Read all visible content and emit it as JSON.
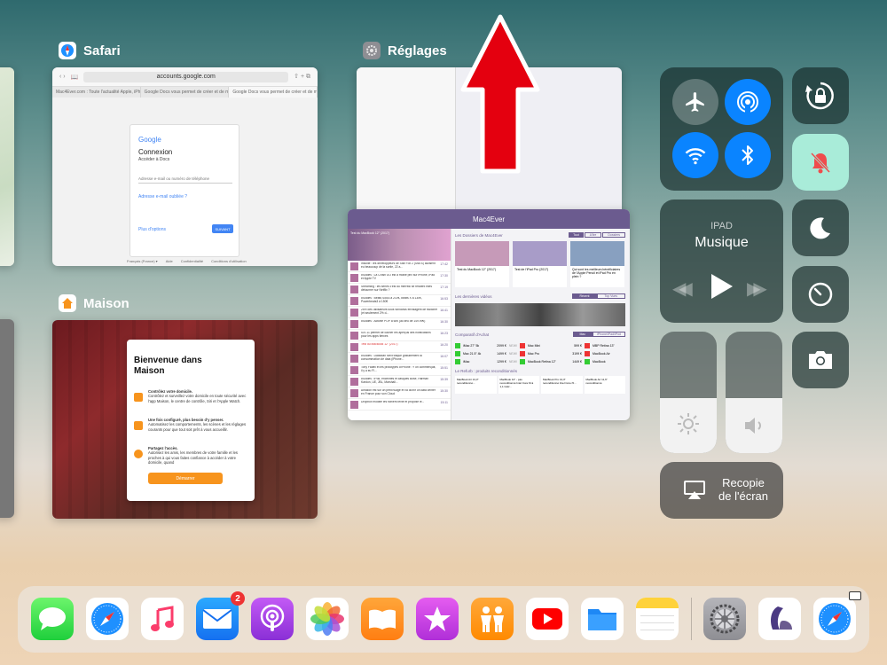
{
  "apps": {
    "safari": {
      "title": "Safari",
      "url": "accounts.google.com",
      "tabs": [
        "Mac4Ever.com : Toute l'actualité Apple, iPhone, iPa...",
        "Google Docs vous permet de créer et de modifier d...",
        "Google Docs vous permet de créer et de modifier..."
      ],
      "login": {
        "logo": "Google",
        "heading": "Connexion",
        "subheading": "Accéder à Docs",
        "email_placeholder": "Adresse e-mail ou numéro de téléphone",
        "forgot_link": "Adresse e-mail oubliée ?",
        "more_options": "Plus d'options",
        "next_button": "SUIVANT",
        "footer": [
          "Français (France) ▾",
          "Aide",
          "Confidentialité",
          "Conditions d'utilisation"
        ]
      }
    },
    "reglages": {
      "title": "Réglages"
    },
    "maison": {
      "title": "Maison",
      "welcome_title": "Bienvenue dans Maison",
      "features": [
        {
          "title": "Contrôlez votre domicile.",
          "text": "Contrôlez et surveillez votre domicile en toute sécurité avec l'app Maison, le centre de contrôle, Siri et l'Apple Watch."
        },
        {
          "title": "Une fois configuré, plus besoin d'y penser.",
          "text": "Automatisez les comportements, les scènes et les réglages courants pour que tout soit prêt à vous accueillir."
        },
        {
          "title": "Partagez l'accès.",
          "text": "Autorisez les amis, les membres de votre famille et les proches à qui vous faites confiance à accéder à votre domicile, quand"
        }
      ],
      "start_button": "Démarrer"
    },
    "mac4ever": {
      "title": "Mac4Ever",
      "featured": "Test du MacBook 12\" (2017)",
      "news": [
        {
          "text": "Insolite : les développeurs de Star Fox 2 (SNES) auraient eu beaucoup de la sortie, 22 a...",
          "time": "17:42"
        },
        {
          "text": "#Soldes : La Crosfi GO est à moitié prix sur iPhone, iPad et Apple TV",
          "time": "17:30"
        },
        {
          "text": "Streaming : les séries c'est du merredi se feraient elles détourner sur Netflix ?",
          "time": "17:19"
        },
        {
          "text": "#Soldes : Beats Solo3 à 210€, Beats X à 130€, Powerbeats3 à 150€",
          "time": "16:53"
        },
        {
          "text": "25% des utilisateurs sous Windows envisagent de switcher (et seulement 2% d...",
          "time": "16:41"
        },
        {
          "text": "#Soldes : Activité POP à 60€ (au lieu de 149.99€)",
          "time": "16:30"
        },
        {
          "text": "iOS 11 permet de cacher les aperçus des notifications pour les apps tierces",
          "time": "16:23"
        },
        {
          "text": "Test du MacBook 12\" (2017)",
          "time": "16:20"
        },
        {
          "text": "#Soldes : DataMan Next traque gratuitement la consommation de data (iPhone...",
          "time": "16:07"
        },
        {
          "text": "Tony Fadell et les prototypes d'iPhone : « on commençait, il y a eu Fl...",
          "time": "15:51"
        },
        {
          "text": "#Soldes : iPod, enceintes et casques Bose, Harman Kardon, UE, JBL, Marshall...",
          "time": "15:39"
        },
        {
          "text": "Amazon est sur un petit nuage et va ouvrir un data center en France pour son Cloud",
          "time": "15:30"
        },
        {
          "text": "Dropbox modifie les fichiers texte et propose le...",
          "time": "15:11"
        }
      ],
      "dossiers_label": "Les Dossiers de Mac4Ever",
      "dossiers_tabs": [
        "Tout",
        "A'lire",
        "Dossiers"
      ],
      "dossiers_cards": [
        "Test du MacBook 12\" (2017)",
        "Test de l'iPad Pro (2017)",
        "Qui sont les meilleurs bénéficiaires de l'Apple Pencil et iPad Pro en plein ?"
      ],
      "videos_label": "Les dernières vidéos",
      "videos_tabs": [
        "Récent",
        "Top Vues"
      ],
      "prices_label": "Comparatif d'Achat",
      "prices_tabs": [
        "Mac",
        "iPhone/iPad/iPod"
      ],
      "prices": [
        {
          "name": "iMac 27\" 5k",
          "price": "2099 €",
          "tag": "NEW!"
        },
        {
          "name": "Mac 21.5\" 4k",
          "price": "1499 €",
          "tag": "NEW!"
        },
        {
          "name": "iMac",
          "price": "1299 €",
          "tag": "NEW!"
        }
      ],
      "prices_right": [
        {
          "name": "Mac Mini",
          "price": "599 €"
        },
        {
          "name": "Mac Pro",
          "price": "3199 €"
        },
        {
          "name": "MacBook Retina 12\"",
          "price": "1449 €"
        }
      ],
      "prices_far": [
        "MBP Retina 13\"",
        "MacBook Air",
        "MacBook"
      ],
      "refurb_label": "Le Refurb : produits reconditionnés",
      "refurb": [
        "MacBook Air 13,3\" reconditionné...",
        "MacBook 12\" - pas reconditionné Intel Core M à 1,1 GHz...",
        "MacBook Pro 13,3\" reconditionné Intel Core i5...",
        "MacBook Air 11,6\" reconditionné"
      ]
    }
  },
  "control_center": {
    "music_device": "IPAD",
    "music_title": "Musique",
    "screen_mirroring": "Recopie de l'écran",
    "brightness": 0.45,
    "volume": 0.45,
    "airplane_mode": false,
    "airdrop": true,
    "wifi": true,
    "bluetooth": true,
    "rotation_lock": false,
    "mute": true,
    "do_not_disturb": false
  },
  "dock": {
    "apps": [
      "Messages",
      "Safari",
      "Musique",
      "Mail",
      "Podcasts",
      "Photos",
      "iBooks",
      "iTunes Store",
      "Localiser mes amis",
      "YouTube",
      "Fichiers",
      "Notes",
      "Réglages",
      "Mac4Ever",
      "Safari"
    ],
    "mail_badge": "2"
  },
  "colors": {
    "accent_blue": "#0a84ff",
    "mute_bg": "#a9ecd9",
    "mute_icon": "#ef4c4c",
    "arrow_red": "#e4000f",
    "google_blue": "#4285f4",
    "maison_orange": "#f7941d"
  }
}
